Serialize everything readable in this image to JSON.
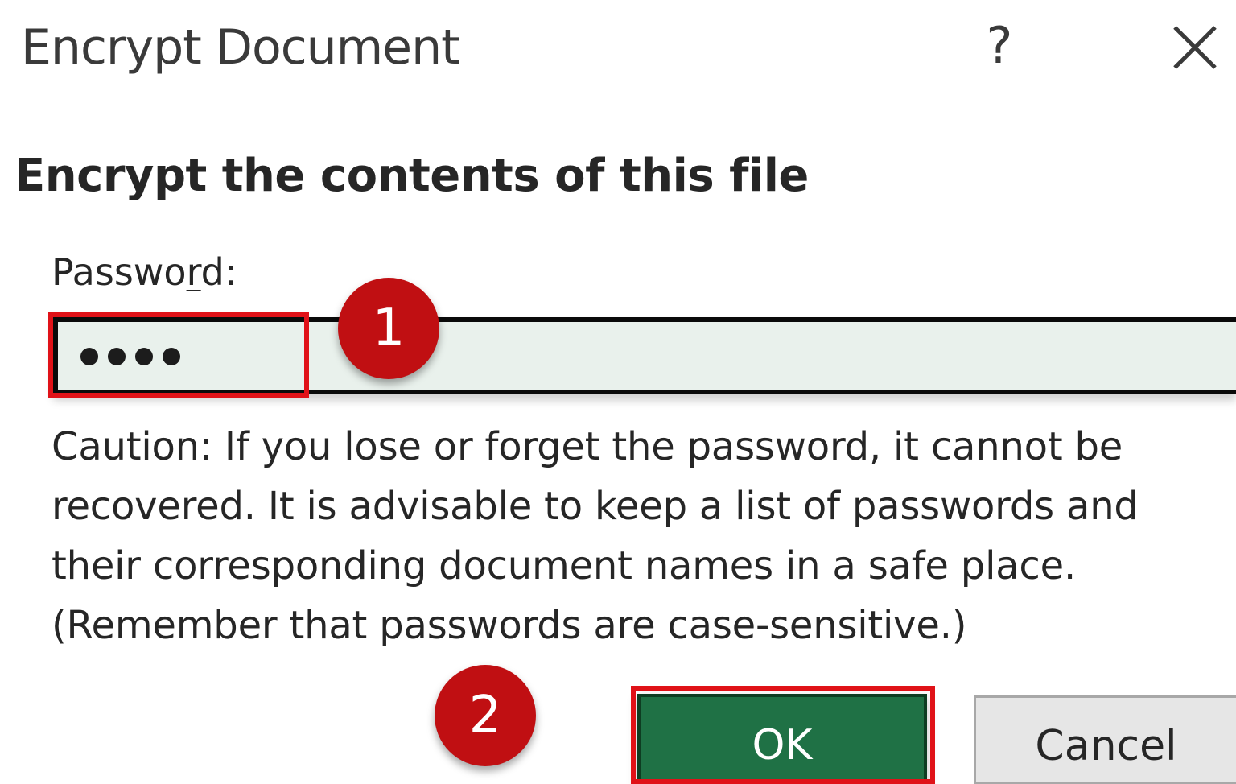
{
  "dialog": {
    "title": "Encrypt Document",
    "help_label": "?",
    "close_icon": "close-icon"
  },
  "heading": "Encrypt the contents of this file",
  "password": {
    "label_before": "Passwo",
    "label_accel": "r",
    "label_after": "d:",
    "masked_length": 4
  },
  "caution": {
    "line1": "Caution: If you lose or forget the password, it cannot be",
    "line2": "recovered. It is advisable to keep a list of passwords and",
    "line3": "their corresponding document names in a safe place.",
    "line4": "(Remember that passwords are case-sensitive.)"
  },
  "buttons": {
    "ok": "OK",
    "cancel": "Cancel"
  },
  "annotations": {
    "step1": "1",
    "step2": "2",
    "highlight_color": "#e01218",
    "badge_color": "#c00f12"
  },
  "colors": {
    "ok_button": "#1f7145",
    "password_field": "#e9f1ec"
  }
}
